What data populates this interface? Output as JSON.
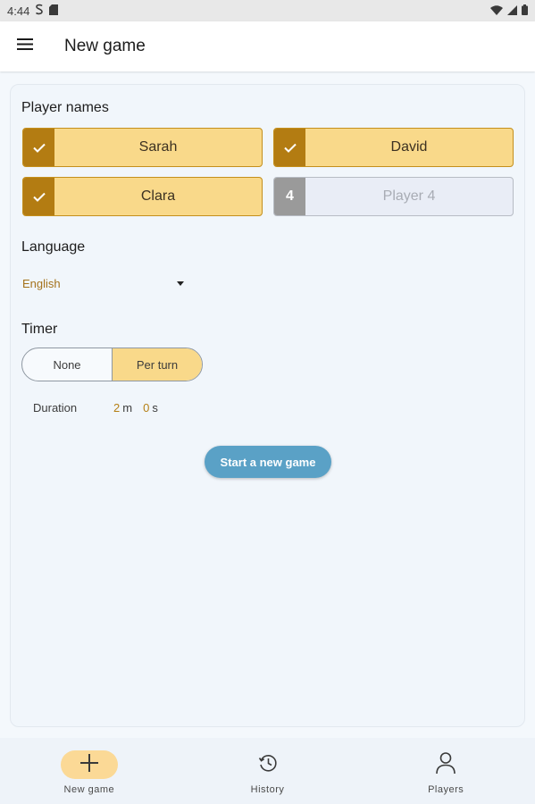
{
  "status_bar": {
    "time": "4:44",
    "icons": [
      "s-notification-icon",
      "sd-card-icon",
      "wifi-icon",
      "signal-icon",
      "battery-icon"
    ]
  },
  "app_bar": {
    "title": "New game",
    "menu_icon": "hamburger-menu-icon"
  },
  "players": {
    "label": "Player names",
    "items": [
      {
        "name": "Sarah",
        "selected": true,
        "badge": "check-icon"
      },
      {
        "name": "David",
        "selected": true,
        "badge": "check-icon"
      },
      {
        "name": "Clara",
        "selected": true,
        "badge": "check-icon"
      },
      {
        "placeholder": "Player 4",
        "selected": false,
        "badge_text": "4"
      }
    ]
  },
  "language": {
    "label": "Language",
    "value": "English"
  },
  "timer": {
    "label": "Timer",
    "options": [
      "None",
      "Per turn"
    ],
    "selected": "Per turn",
    "duration_label": "Duration",
    "minutes": "2",
    "minutes_unit": "m",
    "seconds": "0",
    "seconds_unit": "s"
  },
  "start_button": "Start a new game",
  "bottom_nav": {
    "items": [
      {
        "label": "New game",
        "icon": "plus-icon",
        "active": true
      },
      {
        "label": "History",
        "icon": "history-icon",
        "active": false
      },
      {
        "label": "Players",
        "icon": "person-icon",
        "active": false
      }
    ]
  },
  "colors": {
    "accent_fill": "#f9d98a",
    "accent_dark": "#b37c12",
    "primary_button": "#5aa1c6",
    "background": "#f4f8fc"
  }
}
